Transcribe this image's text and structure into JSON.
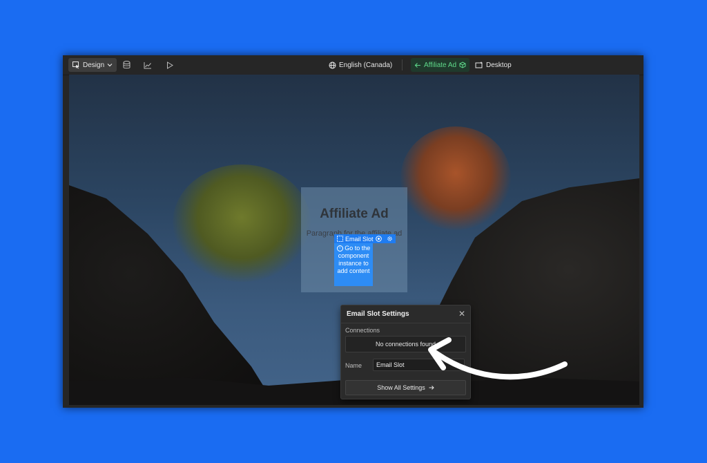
{
  "topbar": {
    "mode_label": "Design",
    "locale_label": "English (Canada)",
    "component_label": "Affiliate Ad",
    "breakpoint_label": "Desktop"
  },
  "canvas": {
    "ad_title": "Affiliate Ad",
    "ad_paragraph": "Paragraph for the affiliate ad",
    "slot_tag_label": "Email Slot",
    "slot_message": "Go to the component instance to add content"
  },
  "settings": {
    "title": "Email Slot Settings",
    "connections_label": "Connections",
    "connections_empty": "No connections found",
    "name_label": "Name",
    "name_value": "Email Slot",
    "show_all_label": "Show All Settings"
  },
  "colors": {
    "page_background": "#1a6cf2",
    "accent_blue": "#1f7cf0",
    "component_green": "#5fd98a"
  }
}
